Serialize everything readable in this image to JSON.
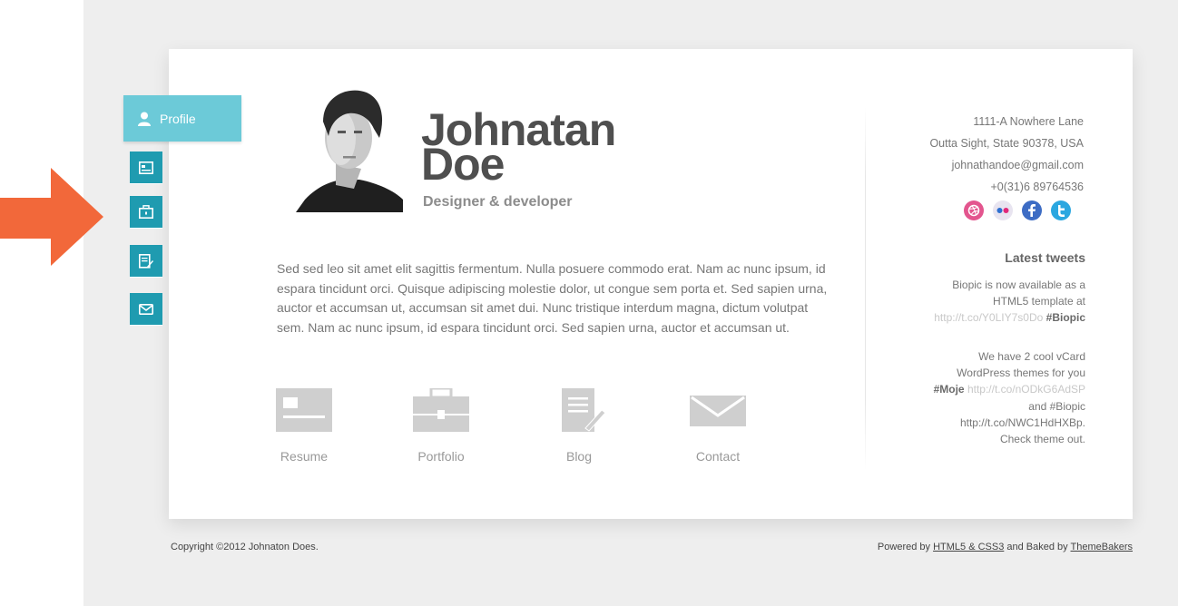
{
  "nav": {
    "profile_label": "Profile",
    "items": [
      "resume-icon",
      "portfolio-icon",
      "blog-icon",
      "contact-icon"
    ]
  },
  "header": {
    "first_name": "Johnatan",
    "last_name": "Doe",
    "role": "Designer & developer"
  },
  "bio": "Sed sed leo sit amet elit sagittis fermentum. Nulla posuere commodo erat. Nam ac nunc ipsum, id espara tincidunt orci. Quisque adipiscing molestie dolor, ut congue sem porta et. Sed sapien urna, auctor et accumsan ut, accumsan sit amet dui. Nunc tristique interdum magna, dictum volutpat sem. Nam ac nunc ipsum, id espara tincidunt orci. Sed sapien urna, auctor et accumsan ut.",
  "sections": [
    {
      "label": "Resume"
    },
    {
      "label": "Portfolio"
    },
    {
      "label": "Blog"
    },
    {
      "label": "Contact"
    }
  ],
  "contact": {
    "address1": "1111-A Nowhere Lane",
    "address2": "Outta Sight, State 90378, USA",
    "email": "johnathandoe@gmail.com",
    "phone": "+0(31)6 89764536"
  },
  "social": [
    {
      "name": "dribbble-icon",
      "color": "#e3558e",
      "glyph": "◎"
    },
    {
      "name": "flickr-icon",
      "color": "#e8e4f0",
      "glyph": "••"
    },
    {
      "name": "facebook-icon",
      "color": "#3d6cc4",
      "glyph": "f"
    },
    {
      "name": "twitter-icon",
      "color": "#2ba7e0",
      "glyph": "t"
    }
  ],
  "tweets": {
    "title": "Latest tweets",
    "t1_line1": "Biopic is now available as a",
    "t1_line2": "HTML5 template at",
    "t1_link": "http://t.co/Y0LIY7s0Do",
    "t1_tag": "#Biopic",
    "t2_line1": "We have 2 cool vCard",
    "t2_line2": "WordPress themes for you",
    "t2_tag": "#Moje",
    "t2_link": "http://t.co/nODkG6AdSP",
    "t2_line3": "and #Biopic",
    "t2_line4": "http://t.co/NWC1HdHXBp.",
    "t2_line5": "Check theme out."
  },
  "footer": {
    "copyright": "Copyright ©2012 Johnaton Does.",
    "powered_prefix": "Powered by ",
    "powered_link": "HTML5 & CSS3",
    "baked_prefix": " and Baked by ",
    "baked_link": "ThemeBakers"
  },
  "colors": {
    "accent": "#1f9bb0",
    "profile_tab": "#6ccad8",
    "arrow": "#f2683a"
  }
}
